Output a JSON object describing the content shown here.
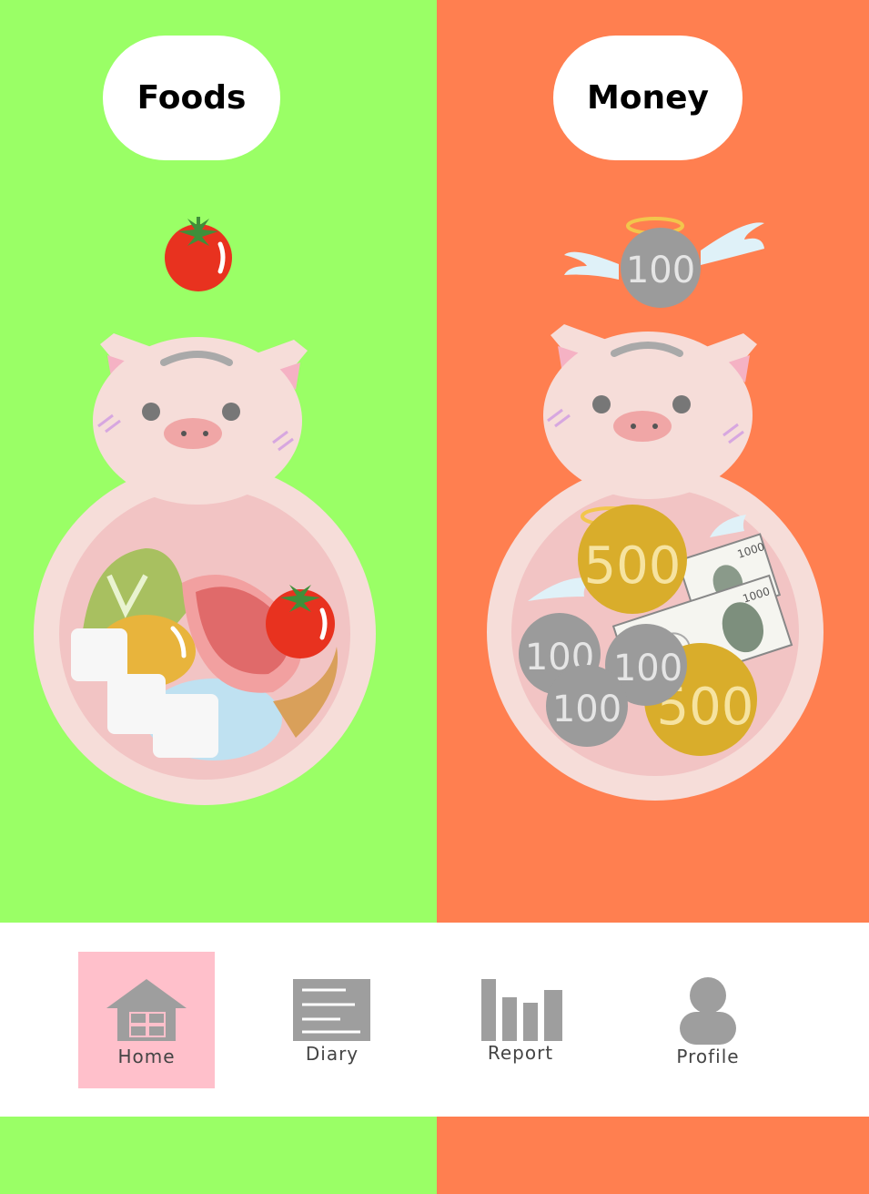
{
  "panels": {
    "foods": {
      "title": "Foods"
    },
    "money": {
      "title": "Money"
    }
  },
  "coins": {
    "flying": "100",
    "small": "100",
    "large": "500",
    "note": "1000"
  },
  "nav": {
    "home": "Home",
    "diary": "Diary",
    "report": "Report",
    "profile": "Profile"
  },
  "colors": {
    "foods_bg": "#9aff66",
    "money_bg": "#ff7f50",
    "active_tab": "#ffc0cb",
    "icon_gray": "#9e9e9e"
  },
  "icons": [
    "tomato-icon",
    "flying-coin-icon",
    "piggy-bank-icon",
    "home-icon",
    "diary-icon",
    "report-icon",
    "profile-icon"
  ]
}
